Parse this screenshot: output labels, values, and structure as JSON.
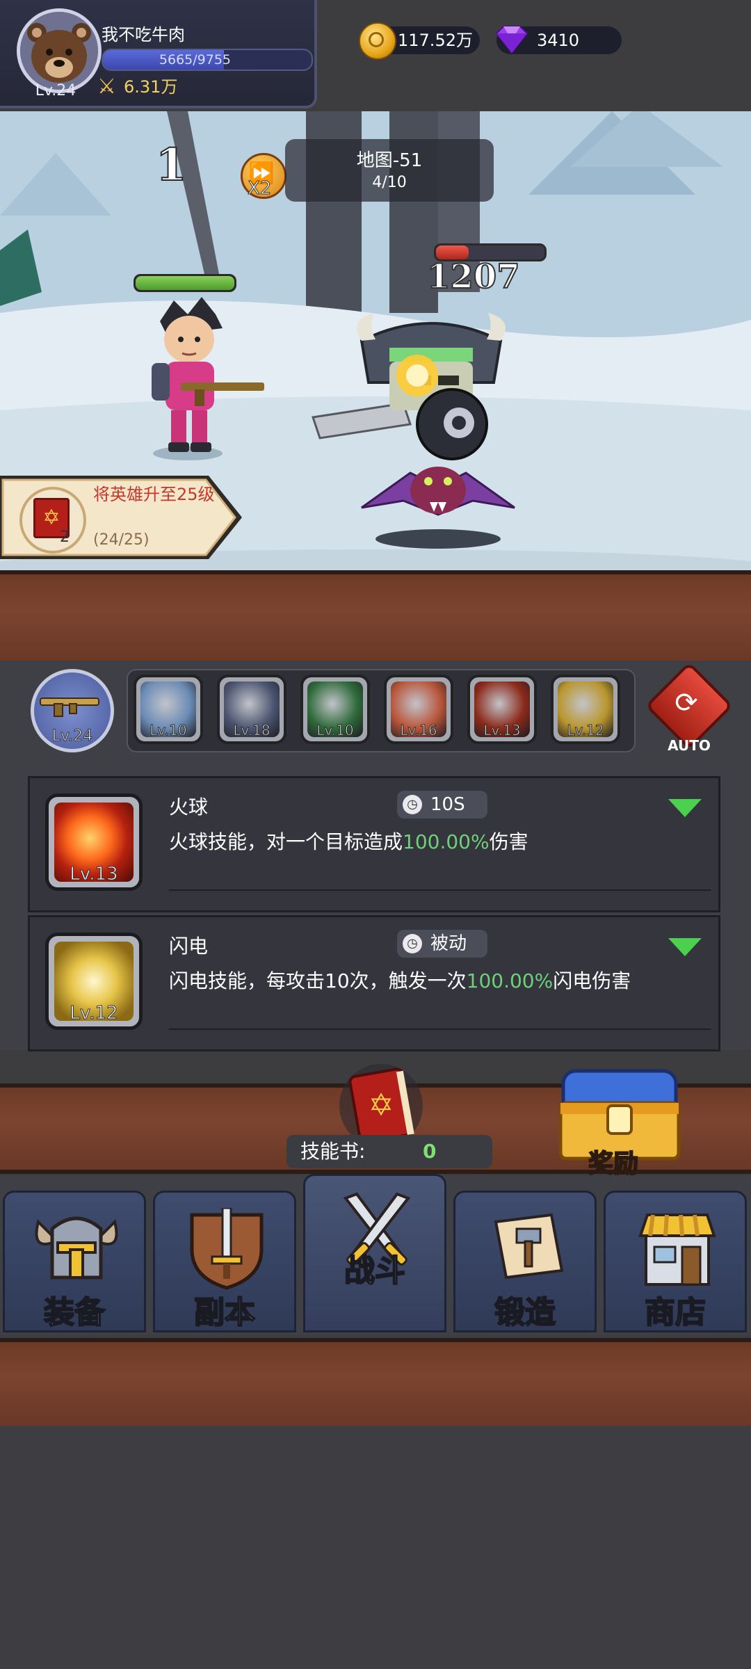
{
  "header": {
    "player_name": "我不吃牛肉",
    "level": "Lv.24",
    "exp_text": "5665/9755",
    "exp_fraction": 0.58,
    "power": "6.31万",
    "gold": "117.52万",
    "gems": "3410"
  },
  "battle": {
    "wave": "1",
    "speed_label": "X2",
    "map_name": "地图-51",
    "map_progress": "4/10",
    "damage": "1207",
    "hero_hp_fraction": 1.0,
    "enemy_hp_fraction": 0.3
  },
  "quest": {
    "title": "将英雄升至25级",
    "progress": "(24/25)",
    "count": "2"
  },
  "weapon": {
    "level": "Lv.24"
  },
  "skill_bar": {
    "auto_label": "AUTO",
    "slots": [
      {
        "level": "Lv.10",
        "color": "#6b8bb5"
      },
      {
        "level": "Lv.18",
        "color": "#4c5570"
      },
      {
        "level": "Lv.10",
        "color": "#2f6a3a"
      },
      {
        "level": "Lv.16",
        "color": "#b8553a"
      },
      {
        "level": "Lv.13",
        "color": "#8b2a1a"
      },
      {
        "level": "Lv.12",
        "color": "#b9962d"
      }
    ]
  },
  "skills": [
    {
      "name": "火球",
      "level": "Lv.13",
      "cooldown": "10S",
      "desc_pre": "火球技能，对一个目标造成",
      "desc_value": "100.00%",
      "desc_post": "伤害",
      "icon": "fireball-icon"
    },
    {
      "name": "闪电",
      "level": "Lv.12",
      "cooldown": "被动",
      "desc_pre": "闪电技能，每攻击10次，触发一次",
      "desc_value": "100.00%",
      "desc_post": "闪电伤害",
      "icon": "lightning-icon"
    }
  ],
  "skill_book": {
    "label": "技能书:",
    "count": "0"
  },
  "reward": {
    "label": "奖励"
  },
  "nav": {
    "equipment": "装备",
    "dungeon": "副本",
    "battle": "战斗",
    "forge": "锻造",
    "shop": "商店"
  }
}
